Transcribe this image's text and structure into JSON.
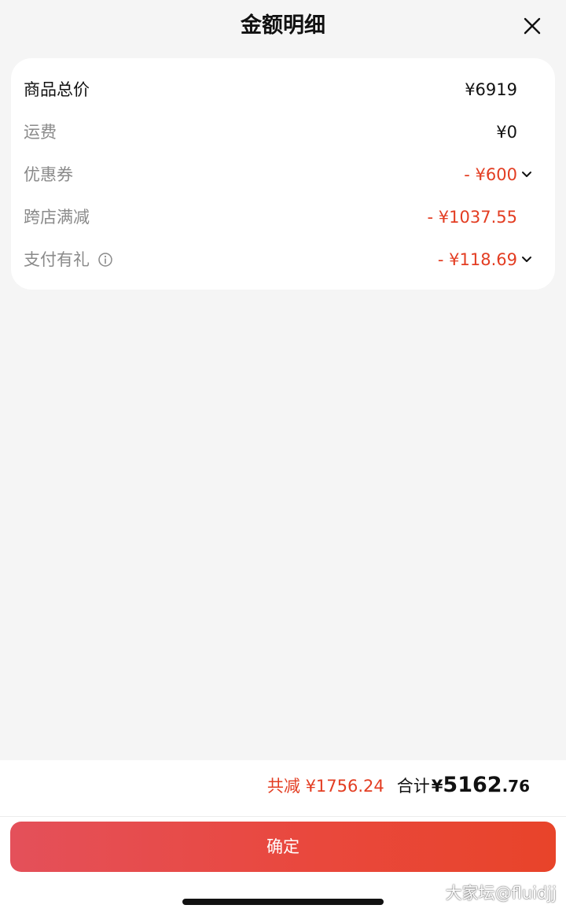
{
  "header": {
    "title": "金额明细"
  },
  "breakdown": {
    "items": [
      {
        "label": "商品总价",
        "value": "¥6919",
        "type": "total"
      },
      {
        "label": "运费",
        "value": "¥0",
        "type": "normal"
      },
      {
        "label": "优惠券",
        "value": "- ¥600",
        "type": "discount",
        "expandable": true
      },
      {
        "label": "跨店满减",
        "value": "- ¥1037.55",
        "type": "discount"
      },
      {
        "label": "支付有礼",
        "value": "- ¥118.69",
        "type": "discount",
        "expandable": true,
        "info_icon": true
      }
    ]
  },
  "summary": {
    "saved": "共减 ¥1756.24",
    "total_label": "合计",
    "total_currency": "¥",
    "total_integer": "5162",
    "total_decimal": ".76"
  },
  "footer": {
    "confirm_label": "确定"
  },
  "watermark": "大家坛@fluidjj",
  "colors": {
    "discount": "#e33d22",
    "muted": "#8a8a8a",
    "background": "#f5f5f5",
    "button_start": "#e4505a",
    "button_end": "#e8442a"
  },
  "icons": {
    "close": "close-icon",
    "expand": "chevron-down-icon",
    "info": "info-icon"
  }
}
